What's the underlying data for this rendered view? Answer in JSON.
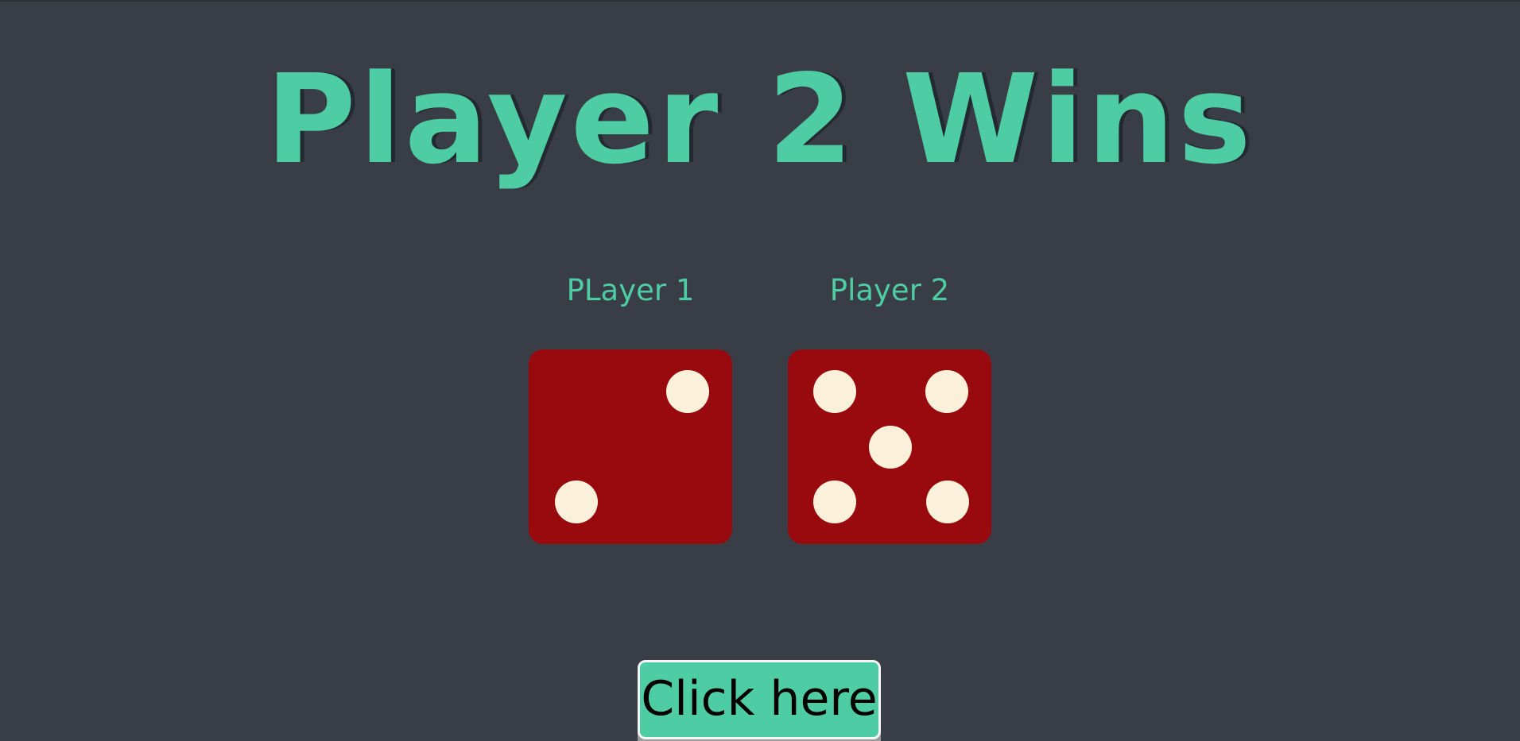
{
  "game": {
    "result_title": "Player 2 Wins",
    "players": [
      {
        "label": "PLayer 1",
        "die_value": 2
      },
      {
        "label": "Player 2",
        "die_value": 5
      }
    ],
    "button_label": "Click here"
  },
  "colors": {
    "background": "#393e46",
    "accent": "#4ecca3",
    "title_shadow": "#232931",
    "die_face": "#990a0f",
    "pip": "#fbf1da",
    "button_text": "#000000"
  },
  "icons": {
    "pip": "die-pip-icon"
  }
}
